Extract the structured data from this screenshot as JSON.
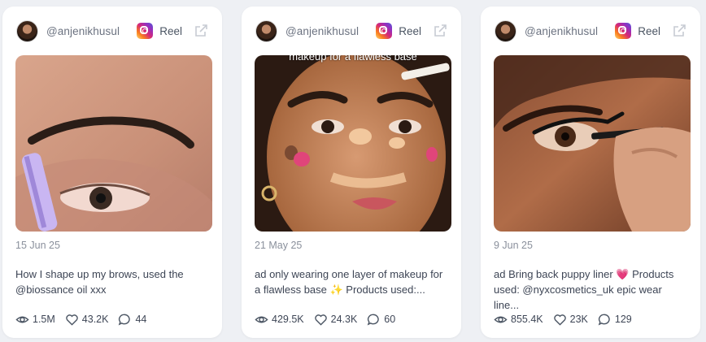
{
  "accent_colors": {
    "instagram": "#d62976",
    "muted_text": "#8a909c"
  },
  "cards": [
    {
      "username": "@anjenikhusul",
      "platform_label": "Reel",
      "overlay_text": "",
      "date": "15 Jun 25",
      "caption": "How I shape up my brows, used the @biossance oil xxx",
      "views": "1.5M",
      "likes": "43.2K",
      "comments": "44"
    },
    {
      "username": "@anjenikhusul",
      "platform_label": "Reel",
      "overlay_text": "makeup for a flawless base",
      "date": "21 May 25",
      "caption": "ad only wearing one layer of makeup for a flawless base ✨ Products used:...",
      "views": "429.5K",
      "likes": "24.3K",
      "comments": "60"
    },
    {
      "username": "@anjenikhusul",
      "platform_label": "Reel",
      "overlay_text": "",
      "date": "9 Jun 25",
      "caption": "ad Bring back puppy liner 💗 Products used: @nyxcosmetics_uk epic wear line...",
      "views": "855.4K",
      "likes": "23K",
      "comments": "129"
    }
  ]
}
